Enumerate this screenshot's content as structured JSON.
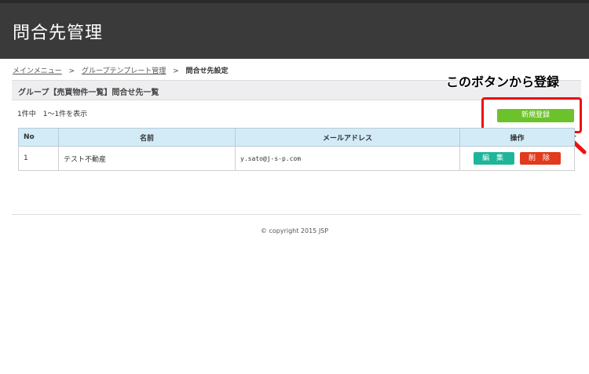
{
  "header": {
    "title": "問合先管理"
  },
  "breadcrumb": {
    "items": [
      "メインメニュー",
      "グループテンプレート管理"
    ],
    "separator": ">",
    "current": "問合せ先設定"
  },
  "section": {
    "title": "グループ【売買物件一覧】問合せ先一覧"
  },
  "result": {
    "count": "1件中　1〜1件を表示"
  },
  "annotation": {
    "label": "このボタンから登録",
    "color": "#ee1111"
  },
  "toolbar": {
    "new_label": "新規登録"
  },
  "table": {
    "headers": {
      "no": "No",
      "name": "名前",
      "email": "メールアドレス",
      "ops": "操作"
    },
    "rows": [
      {
        "no": "1",
        "name": "テスト不動産",
        "email": "y.sato@j-s-p.com",
        "edit": "編 集",
        "delete": "削 除"
      }
    ]
  },
  "footer": {
    "copyright": "© copyright 2015 JSP"
  },
  "colors": {
    "header_bg": "#3a3a3a",
    "accent_green": "#6cc22b",
    "edit_teal": "#1fb59a",
    "delete_red": "#e13a1c"
  }
}
